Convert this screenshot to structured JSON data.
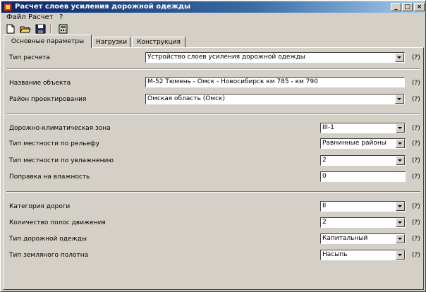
{
  "window": {
    "title": "Расчет слоев усиления дорожной одежды"
  },
  "menu": [
    "Файл",
    "Расчет",
    "?"
  ],
  "toolbar": {
    "icons": [
      "new-document-icon",
      "open-folder-icon",
      "save-disk-icon",
      "calculator-icon"
    ]
  },
  "tabs": [
    "Основные параметры",
    "Нагрузки",
    "Конструкция"
  ],
  "form": {
    "calc_type": {
      "label": "Тип расчета",
      "value": "Устройство слоев усиления дорожной одежды"
    },
    "object_name": {
      "label": "Название объекта",
      "value": "М-52 Тюмень - Омск - Новосибирск км 785 - км 790"
    },
    "design_region": {
      "label": "Район проектирования",
      "value": "Омская область (Омск)"
    },
    "climate_zone": {
      "label": "Дорожно-климатическая зона",
      "value": "III-1"
    },
    "relief_type": {
      "label": "Тип местности по рельефу",
      "value": "Равнинные районы"
    },
    "moisture_type": {
      "label": "Тип местности по увлажнению",
      "value": "2"
    },
    "moisture_correction": {
      "label": "Поправка на влажность",
      "value": "0"
    },
    "road_category": {
      "label": "Категория дороги",
      "value": "II"
    },
    "lanes": {
      "label": "Количество полос движения",
      "value": "2"
    },
    "pavement_type": {
      "label": "Тип дорожной одежды",
      "value": "Капитальный"
    },
    "subgrade_type": {
      "label": "Тип земляного полотна",
      "value": "Насыпь"
    }
  },
  "help_label": "(?)",
  "colors": {
    "window_face": "#d4d0c8",
    "title_start": "#0a246a",
    "title_end": "#a6caf0"
  }
}
